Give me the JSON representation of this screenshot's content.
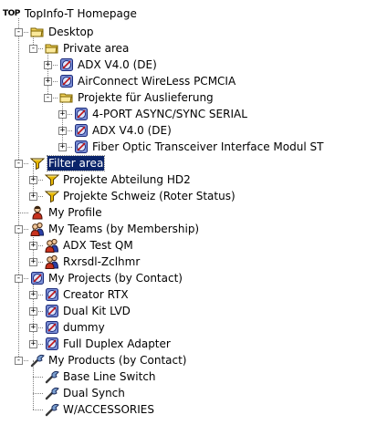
{
  "tree": {
    "root": {
      "logo_text": "TOP",
      "label": "TopInfo-T Homepage"
    },
    "nodes": [
      {
        "id": "desktop",
        "label": "Desktop",
        "icon": "folder-open-icon",
        "level": 0,
        "toggle": "-"
      },
      {
        "id": "private-area",
        "label": "Private area",
        "icon": "folder-open-icon",
        "level": 1,
        "toggle": "-"
      },
      {
        "id": "adx-v40-de-1",
        "label": "ADX V4.0 (DE)",
        "icon": "project-icon",
        "level": 2,
        "toggle": "+"
      },
      {
        "id": "airconnect",
        "label": "AirConnect WireLess PCMCIA",
        "icon": "project-icon",
        "level": 2,
        "toggle": "+"
      },
      {
        "id": "projekte-auslieferung",
        "label": "Projekte für Auslieferung",
        "icon": "folder-open-icon",
        "level": 2,
        "toggle": "-"
      },
      {
        "id": "4-port",
        "label": "4-PORT ASYNC/SYNC SERIAL",
        "icon": "project-icon",
        "level": 3,
        "toggle": "+"
      },
      {
        "id": "adx-v40-de-2",
        "label": "ADX V4.0 (DE)",
        "icon": "project-icon",
        "level": 3,
        "toggle": "+"
      },
      {
        "id": "fiber-optic",
        "label": "Fiber Optic Transceiver Interface Modul ST",
        "icon": "project-icon",
        "level": 3,
        "toggle": "+"
      },
      {
        "id": "filter-area",
        "label": "Filter area",
        "icon": "filter-icon",
        "level": 0,
        "toggle": "-",
        "selected": true
      },
      {
        "id": "projekte-hd2",
        "label": "Projekte Abteilung HD2",
        "icon": "filter-icon",
        "level": 1,
        "toggle": "+"
      },
      {
        "id": "projekte-schweiz",
        "label": "Projekte Schweiz (Roter Status)",
        "icon": "filter-icon",
        "level": 1,
        "toggle": "+"
      },
      {
        "id": "my-profile",
        "label": "My Profile",
        "icon": "person-icon",
        "level": 0,
        "toggle": ""
      },
      {
        "id": "my-teams",
        "label": "My Teams (by Membership)",
        "icon": "team-icon",
        "level": 0,
        "toggle": "-"
      },
      {
        "id": "adx-test-qm",
        "label": "ADX Test QM",
        "icon": "team-icon",
        "level": 1,
        "toggle": "+"
      },
      {
        "id": "rxrsdl",
        "label": "Rxrsdl-Zclhmr",
        "icon": "team-icon",
        "level": 1,
        "toggle": "+"
      },
      {
        "id": "my-projects",
        "label": "My Projects (by Contact)",
        "icon": "project-icon",
        "level": 0,
        "toggle": "-"
      },
      {
        "id": "creator-rtx",
        "label": "Creator RTX",
        "icon": "project-icon",
        "level": 1,
        "toggle": "+"
      },
      {
        "id": "dual-kit-lvd",
        "label": "Dual Kit LVD",
        "icon": "project-icon",
        "level": 1,
        "toggle": "+"
      },
      {
        "id": "dummy",
        "label": "dummy",
        "icon": "project-icon",
        "level": 1,
        "toggle": "+"
      },
      {
        "id": "full-duplex",
        "label": "Full Duplex Adapter",
        "icon": "project-icon",
        "level": 1,
        "toggle": "+"
      },
      {
        "id": "my-products",
        "label": "My Products (by Contact)",
        "icon": "product-icon",
        "level": 0,
        "toggle": "-"
      },
      {
        "id": "base-line-switch",
        "label": "Base Line Switch",
        "icon": "product-icon",
        "level": 1,
        "toggle": ""
      },
      {
        "id": "dual-synch",
        "label": "Dual Synch",
        "icon": "product-icon",
        "level": 1,
        "toggle": ""
      },
      {
        "id": "waccessories",
        "label": "W/ACCESSORIES",
        "icon": "product-icon",
        "level": 1,
        "toggle": ""
      }
    ]
  },
  "colors": {
    "selection_bg": "#0a246a",
    "folder_yellow": "#f3d35a",
    "project_blue": "#7b8fd6",
    "filter_yellow": "#e8b800",
    "person_red": "#c8321e"
  }
}
